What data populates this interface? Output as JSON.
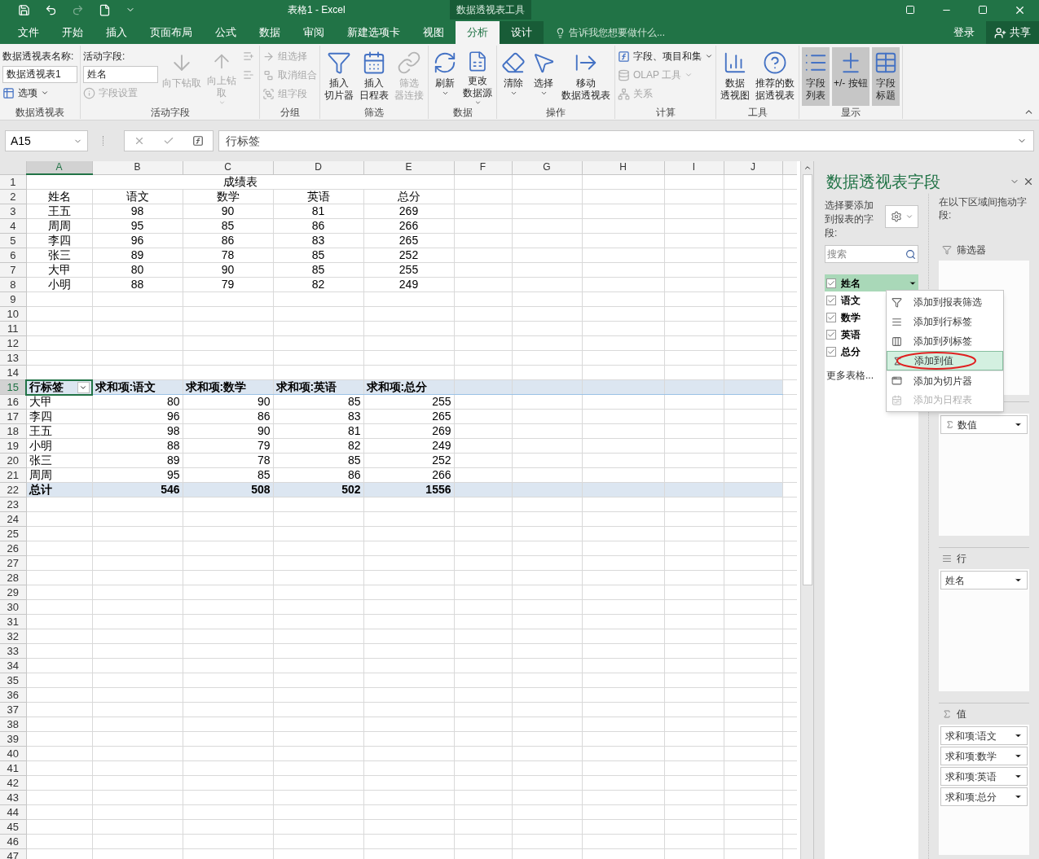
{
  "title_bar": {
    "title": "表格1 - Excel",
    "context_tab": "数据透视表工具"
  },
  "menu_tabs": [
    {
      "label": "文件",
      "selected": false
    },
    {
      "label": "开始",
      "selected": false
    },
    {
      "label": "插入",
      "selected": false
    },
    {
      "label": "页面布局",
      "selected": false
    },
    {
      "label": "公式",
      "selected": false
    },
    {
      "label": "数据",
      "selected": false
    },
    {
      "label": "审阅",
      "selected": false
    },
    {
      "label": "新建选项卡",
      "selected": false
    },
    {
      "label": "视图",
      "selected": false
    },
    {
      "label": "分析",
      "selected": true
    },
    {
      "label": "设计",
      "selected": false
    }
  ],
  "tell_me": {
    "placeholder": "告诉我您想要做什么..."
  },
  "sign_in": "登录",
  "share": "共享",
  "ribbon_groups": [
    {
      "label": "数据透视表",
      "controls": [
        {
          "kind": "label",
          "label": "数据透视表名称:"
        },
        {
          "kind": "field",
          "value": "数据透视表1"
        },
        {
          "kind": "small",
          "label": "选项",
          "disabled": false,
          "dropdown": true
        }
      ]
    },
    {
      "label": "活动字段",
      "controls": [
        {
          "kind": "label",
          "label": "活动字段:"
        },
        {
          "kind": "field",
          "value": "姓名"
        },
        {
          "kind": "small",
          "label": "字段设置",
          "disabled": true,
          "dropdown": false
        },
        {
          "kind": "large",
          "lines": [
            "向下钻取"
          ],
          "disabled": true,
          "dropdown": false
        },
        {
          "kind": "large",
          "lines": [
            "向上钻",
            "取"
          ],
          "disabled": true,
          "dropdown": true
        },
        {
          "kind": "icon",
          "disabled": true
        },
        {
          "kind": "icon",
          "disabled": true
        }
      ]
    },
    {
      "label": "分组",
      "controls": [
        {
          "kind": "small",
          "label": "组选择",
          "disabled": true,
          "dropdown": false
        },
        {
          "kind": "small",
          "label": "取消组合",
          "disabled": true,
          "dropdown": false
        },
        {
          "kind": "small",
          "label": "组字段",
          "disabled": true,
          "dropdown": false
        }
      ]
    },
    {
      "label": "筛选",
      "controls": [
        {
          "kind": "large",
          "lines": [
            "插入",
            "切片器"
          ],
          "disabled": false,
          "dropdown": false
        },
        {
          "kind": "large",
          "lines": [
            "插入",
            "日程表"
          ],
          "disabled": false,
          "dropdown": false
        },
        {
          "kind": "large",
          "lines": [
            "筛选",
            "器连接"
          ],
          "disabled": true,
          "dropdown": false
        }
      ]
    },
    {
      "label": "数据",
      "controls": [
        {
          "kind": "large",
          "lines": [
            "刷新"
          ],
          "disabled": false,
          "dropdown": true
        },
        {
          "kind": "large",
          "lines": [
            "更改",
            "数据源"
          ],
          "disabled": false,
          "dropdown": true
        }
      ]
    },
    {
      "label": "操作",
      "controls": [
        {
          "kind": "large",
          "lines": [
            "清除"
          ],
          "disabled": false,
          "dropdown": true
        },
        {
          "kind": "large",
          "lines": [
            "选择"
          ],
          "disabled": false,
          "dropdown": true
        },
        {
          "kind": "large",
          "lines": [
            "移动",
            "数据透视表"
          ],
          "disabled": false,
          "dropdown": false
        }
      ]
    },
    {
      "label": "计算",
      "controls": [
        {
          "kind": "small",
          "label": "字段、项目和集",
          "disabled": false,
          "dropdown": true
        },
        {
          "kind": "small",
          "label": "OLAP 工具",
          "disabled": true,
          "dropdown": true
        },
        {
          "kind": "small",
          "label": "关系",
          "disabled": true,
          "dropdown": false
        }
      ]
    },
    {
      "label": "工具",
      "controls": [
        {
          "kind": "large",
          "lines": [
            "数据",
            "透视图"
          ],
          "disabled": false,
          "dropdown": false
        },
        {
          "kind": "large",
          "lines": [
            "推荐的数",
            "据透视表"
          ],
          "disabled": false,
          "dropdown": false
        }
      ]
    },
    {
      "label": "显示",
      "controls": [
        {
          "kind": "large",
          "lines": [
            "字段",
            "列表"
          ],
          "disabled": false,
          "dropdown": false,
          "on": true
        },
        {
          "kind": "large",
          "lines": [
            "+/- 按钮"
          ],
          "disabled": false,
          "dropdown": false,
          "on": true
        },
        {
          "kind": "large",
          "lines": [
            "字段",
            "标题"
          ],
          "disabled": false,
          "dropdown": false,
          "on": true
        }
      ]
    }
  ],
  "formula_bar": {
    "name_box": "A15",
    "formula": "行标签"
  },
  "sheet": {
    "columns": [
      {
        "letter": "A",
        "selected": true
      },
      {
        "letter": "B",
        "selected": false
      },
      {
        "letter": "C",
        "selected": false
      },
      {
        "letter": "D",
        "selected": false
      },
      {
        "letter": "E",
        "selected": false
      },
      {
        "letter": "F",
        "selected": false
      },
      {
        "letter": "G",
        "selected": false
      },
      {
        "letter": "H",
        "selected": false
      },
      {
        "letter": "I",
        "selected": false
      },
      {
        "letter": "J",
        "selected": false
      }
    ],
    "rows": [
      {
        "number": "1",
        "selected": false,
        "kind": "title",
        "cells": [
          "成绩表"
        ]
      },
      {
        "number": "2",
        "selected": false,
        "kind": "data",
        "cells": [
          "姓名",
          "语文",
          "数学",
          "英语",
          "总分"
        ]
      },
      {
        "number": "3",
        "selected": false,
        "kind": "data",
        "cells": [
          "王五",
          "98",
          "90",
          "81",
          "269"
        ]
      },
      {
        "number": "4",
        "selected": false,
        "kind": "data",
        "cells": [
          "周周",
          "95",
          "85",
          "86",
          "266"
        ]
      },
      {
        "number": "5",
        "selected": false,
        "kind": "data",
        "cells": [
          "李四",
          "96",
          "86",
          "83",
          "265"
        ]
      },
      {
        "number": "6",
        "selected": false,
        "kind": "data",
        "cells": [
          "张三",
          "89",
          "78",
          "85",
          "252"
        ]
      },
      {
        "number": "7",
        "selected": false,
        "kind": "data",
        "cells": [
          "大甲",
          "80",
          "90",
          "85",
          "255"
        ]
      },
      {
        "number": "8",
        "selected": false,
        "kind": "data",
        "cells": [
          "小明",
          "88",
          "79",
          "82",
          "249"
        ]
      },
      {
        "number": "9",
        "selected": false,
        "kind": "empty"
      },
      {
        "number": "10",
        "selected": false,
        "kind": "empty"
      },
      {
        "number": "11",
        "selected": false,
        "kind": "empty"
      },
      {
        "number": "12",
        "selected": false,
        "kind": "empty"
      },
      {
        "number": "13",
        "selected": false,
        "kind": "empty"
      },
      {
        "number": "14",
        "selected": false,
        "kind": "empty"
      },
      {
        "number": "15",
        "selected": true,
        "kind": "pivot_header",
        "cells": [
          "行标签",
          "求和项:语文",
          "求和项:数学",
          "求和项:英语",
          "求和项:总分"
        ]
      },
      {
        "number": "16",
        "selected": false,
        "kind": "pivot_row",
        "cells": [
          "大甲",
          "80",
          "90",
          "85",
          "255"
        ]
      },
      {
        "number": "17",
        "selected": false,
        "kind": "pivot_row",
        "cells": [
          "李四",
          "96",
          "86",
          "83",
          "265"
        ]
      },
      {
        "number": "18",
        "selected": false,
        "kind": "pivot_row",
        "cells": [
          "王五",
          "98",
          "90",
          "81",
          "269"
        ]
      },
      {
        "number": "19",
        "selected": false,
        "kind": "pivot_row",
        "cells": [
          "小明",
          "88",
          "79",
          "82",
          "249"
        ]
      },
      {
        "number": "20",
        "selected": false,
        "kind": "pivot_row",
        "cells": [
          "张三",
          "89",
          "78",
          "85",
          "252"
        ]
      },
      {
        "number": "21",
        "selected": false,
        "kind": "pivot_row",
        "cells": [
          "周周",
          "95",
          "85",
          "86",
          "266"
        ]
      },
      {
        "number": "22",
        "selected": false,
        "kind": "pivot_total",
        "cells": [
          "总计",
          "546",
          "508",
          "502",
          "1556"
        ]
      },
      {
        "number": "23",
        "selected": false,
        "kind": "empty"
      },
      {
        "number": "24",
        "selected": false,
        "kind": "empty"
      },
      {
        "number": "25",
        "selected": false,
        "kind": "empty"
      },
      {
        "number": "26",
        "selected": false,
        "kind": "empty"
      },
      {
        "number": "27",
        "selected": false,
        "kind": "empty"
      },
      {
        "number": "28",
        "selected": false,
        "kind": "empty"
      },
      {
        "number": "29",
        "selected": false,
        "kind": "empty"
      },
      {
        "number": "30",
        "selected": false,
        "kind": "empty"
      },
      {
        "number": "31",
        "selected": false,
        "kind": "empty"
      },
      {
        "number": "32",
        "selected": false,
        "kind": "empty"
      },
      {
        "number": "33",
        "selected": false,
        "kind": "empty"
      },
      {
        "number": "34",
        "selected": false,
        "kind": "empty"
      },
      {
        "number": "35",
        "selected": false,
        "kind": "empty"
      },
      {
        "number": "36",
        "selected": false,
        "kind": "empty"
      },
      {
        "number": "37",
        "selected": false,
        "kind": "empty"
      },
      {
        "number": "38",
        "selected": false,
        "kind": "empty"
      },
      {
        "number": "39",
        "selected": false,
        "kind": "empty"
      },
      {
        "number": "40",
        "selected": false,
        "kind": "empty"
      },
      {
        "number": "41",
        "selected": false,
        "kind": "empty"
      },
      {
        "number": "42",
        "selected": false,
        "kind": "empty"
      },
      {
        "number": "43",
        "selected": false,
        "kind": "empty"
      },
      {
        "number": "44",
        "selected": false,
        "kind": "empty"
      },
      {
        "number": "45",
        "selected": false,
        "kind": "empty"
      },
      {
        "number": "46",
        "selected": false,
        "kind": "empty"
      },
      {
        "number": "47",
        "selected": false,
        "kind": "empty"
      }
    ]
  },
  "field_panel": {
    "title": "数据透视表字段",
    "choose_hint": "选择要添加到报表的字段:",
    "drag_hint": "在以下区域间拖动字段:",
    "search": {
      "placeholder": "搜索"
    },
    "fields": [
      {
        "label": "姓名",
        "checked": true,
        "selected": true
      },
      {
        "label": "语文",
        "checked": true,
        "selected": false
      },
      {
        "label": "数学",
        "checked": true,
        "selected": false
      },
      {
        "label": "英语",
        "checked": true,
        "selected": false
      },
      {
        "label": "总分",
        "checked": true,
        "selected": false
      }
    ],
    "more_tables": "更多表格...",
    "context_menu": [
      {
        "label": "添加到报表筛选",
        "disabled": false,
        "selected": false,
        "circled": false
      },
      {
        "label": "添加到行标签",
        "disabled": false,
        "selected": false,
        "circled": false
      },
      {
        "label": "添加到列标签",
        "disabled": false,
        "selected": false,
        "circled": false
      },
      {
        "label": "添加到值",
        "disabled": false,
        "selected": true,
        "circled": true
      },
      {
        "label": "添加为切片器",
        "disabled": false,
        "selected": false,
        "circled": false
      },
      {
        "label": "添加为日程表",
        "disabled": true,
        "selected": false,
        "circled": false
      }
    ],
    "areas": [
      {
        "kind": "filters",
        "label": "筛选器"
      },
      {
        "kind": "columns",
        "items": [
          "数值"
        ]
      },
      {
        "kind": "rows",
        "label": "行",
        "items": [
          "姓名"
        ]
      },
      {
        "kind": "values",
        "label": "值",
        "items": [
          "求和项:语文",
          "求和项:数学",
          "求和项:英语",
          "求和项:总分"
        ]
      }
    ]
  }
}
